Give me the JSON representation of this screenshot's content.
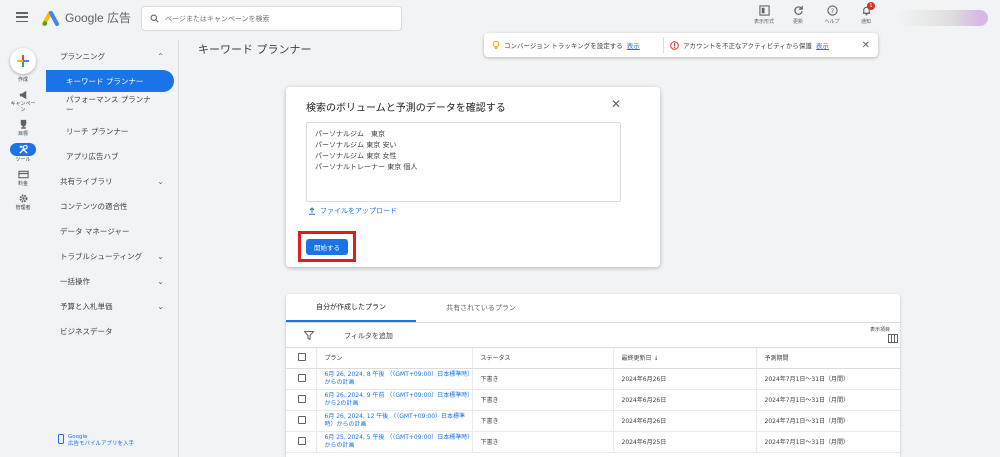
{
  "app": {
    "name": "Google 広告"
  },
  "search": {
    "placeholder": "ページまたはキャンペーンを検索"
  },
  "top_icons": [
    {
      "icon": "display-format-icon",
      "label": "表示形式"
    },
    {
      "icon": "refresh-icon",
      "label": "更新"
    },
    {
      "icon": "help-icon",
      "label": "ヘルプ"
    },
    {
      "icon": "bell-icon",
      "label": "通知",
      "badge": "1"
    }
  ],
  "rail": [
    {
      "icon": "create-icon",
      "label": "作成"
    },
    {
      "icon": "megaphone-icon",
      "label": "キャンペーン"
    },
    {
      "icon": "trophy-icon",
      "label": "目標"
    },
    {
      "icon": "tools-icon",
      "label": "ツール",
      "active": true
    },
    {
      "icon": "billing-icon",
      "label": "料金"
    },
    {
      "icon": "gear-icon",
      "label": "管理者"
    }
  ],
  "nav": {
    "planning": "プランニング",
    "keyword_planner": "キーワード プランナー",
    "performance_planner": "パフォーマンス プランナー",
    "reach_planner": "リーチ プランナー",
    "app_ad_hub": "アプリ広告ハブ",
    "shared_library": "共有ライブラリ",
    "content_suitability": "コンテンツの適合性",
    "data_manager": "データ マネージャー",
    "troubleshooting": "トラブルシューティング",
    "bulk_actions": "一括操作",
    "budgets_bidding": "予算と入札単価",
    "business_data": "ビジネスデータ",
    "footer_brand": "Google",
    "footer_link": "広告モバイルアプリを入手"
  },
  "page": {
    "title": "キーワード プランナー"
  },
  "notifications": {
    "first_text": "コンバージョン トラッキングを設定する",
    "first_link": "表示",
    "second_text": "アカウントを不正なアクティビティから保護",
    "second_link": "表示"
  },
  "dialog": {
    "title": "検索のボリュームと予測のデータを確認する",
    "keywords": "パーソナルジム　東京\nパーソナルジム 東京 安い\nパーソナルジム 東京 女性\nパーソナルトレーナー 東京 個人",
    "upload_label": "ファイルをアップロード",
    "start_label": "開始する"
  },
  "plans": {
    "tabs": [
      "自分が作成したプラン",
      "共有されているプラン"
    ],
    "filter_label": "フィルタを追加",
    "columns_label": "表示項目",
    "headers": [
      "プラン",
      "ステータス",
      "最終更新日",
      "予測期間"
    ],
    "sort_arrow": "↓",
    "rows": [
      {
        "name": "6月 26, 2024, 8 午後 （（GMT+09:00）日本標準時）からの計画",
        "status": "下書き",
        "updated": "2024年6月26日",
        "period": "2024年7月1日～31日（月間）"
      },
      {
        "name": "6月 26, 2024, 9 午前 （（GMT+09:00）日本標準時）から2の計画",
        "status": "下書き",
        "updated": "2024年6月26日",
        "period": "2024年7月1日～31日（月間）"
      },
      {
        "name": "6月 26, 2024, 12 午後 （（GMT+09:00）日本標準時）からの計画",
        "status": "下書き",
        "updated": "2024年6月26日",
        "period": "2024年7月1日～31日（月間）"
      },
      {
        "name": "6月 25, 2024, 5 午後 （（GMT+09:00）日本標準時）からの計画",
        "status": "下書き",
        "updated": "2024年6月25日",
        "period": "2024年7月1日～31日（月間）"
      }
    ]
  },
  "colors": {
    "accent": "#1a73e8",
    "highlight": "#e11d1d",
    "background": "#f1f3f4"
  }
}
